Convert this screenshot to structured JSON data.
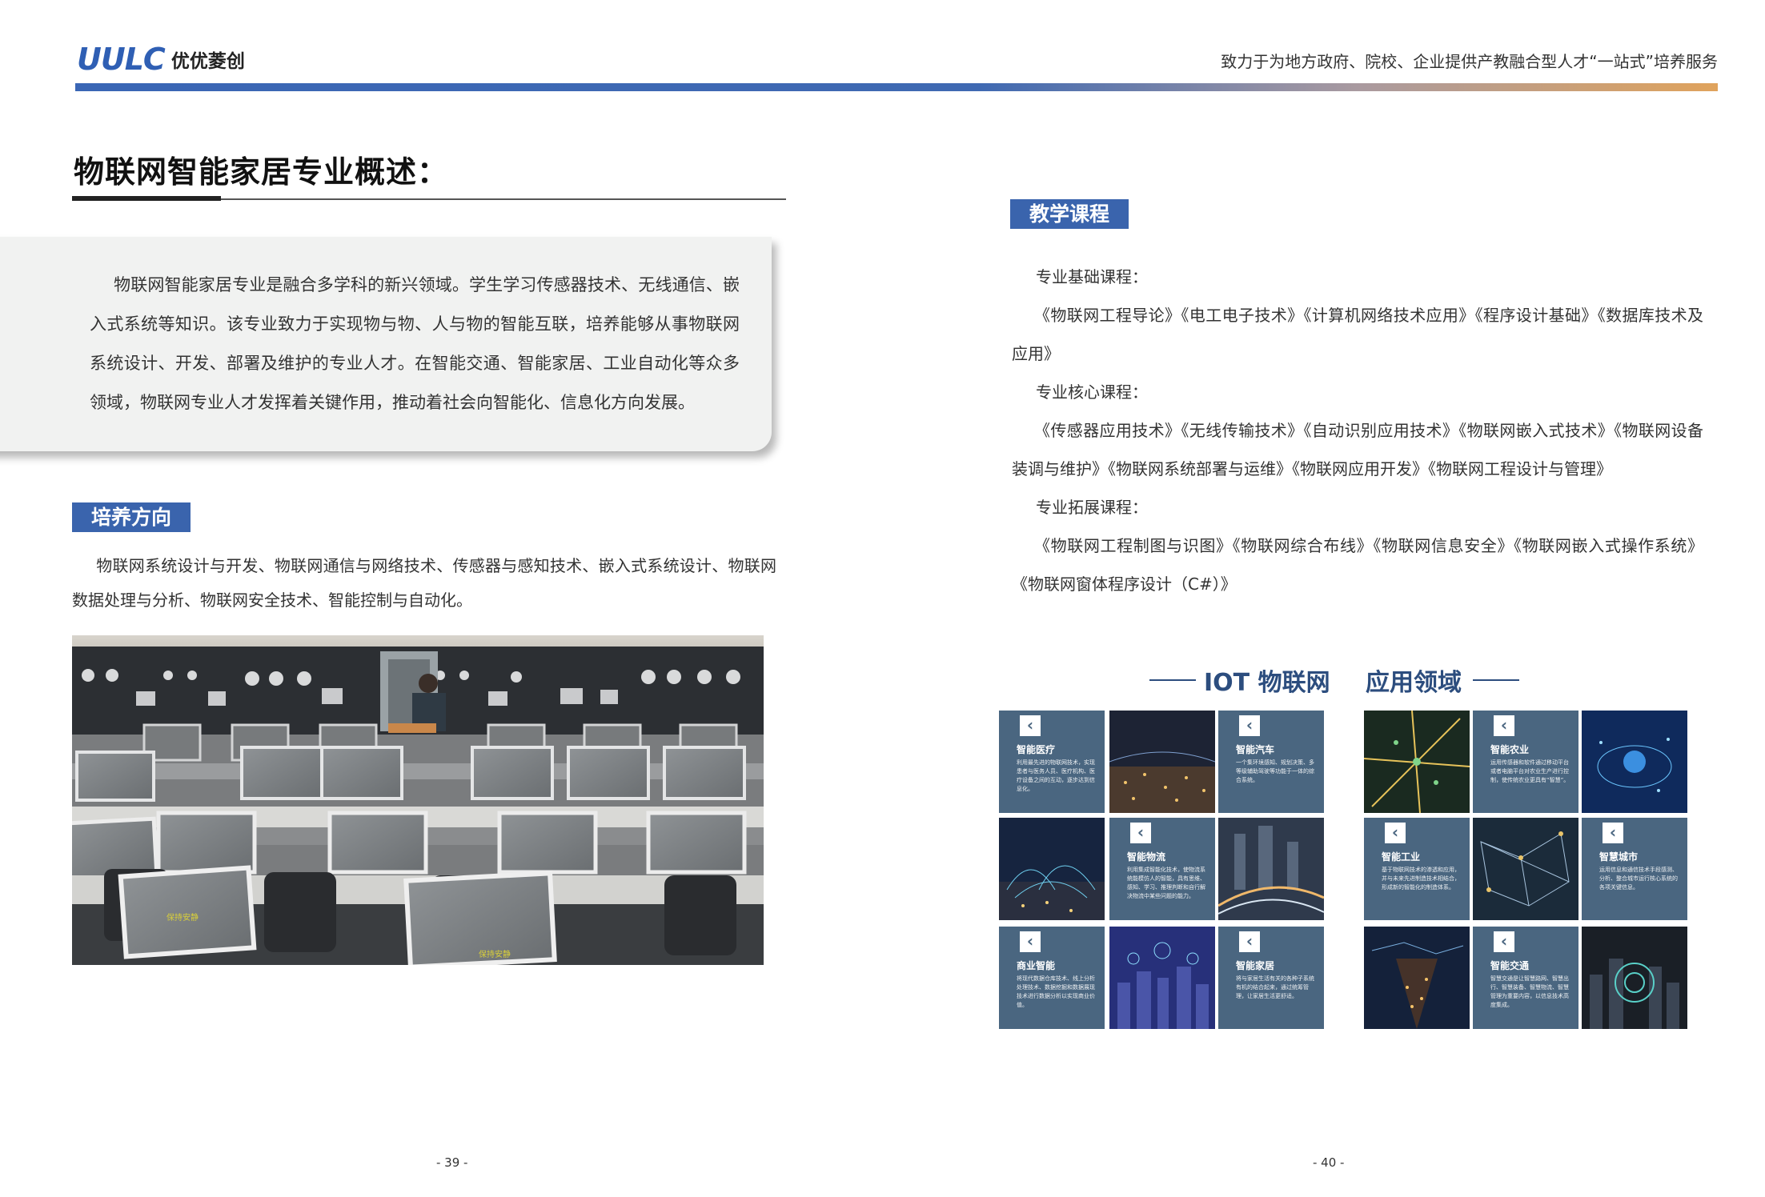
{
  "header": {
    "logo_mark": "UULC",
    "logo_cn": "优优菱创",
    "tagline": "致力于为地方政府、院校、企业提供产教融合型人才“一站式”培养服务"
  },
  "left_page": {
    "title": "物联网智能家居专业概述：",
    "intro": "物联网智能家居专业是融合多学科的新兴领域。学生学习传感器技术、无线通信、嵌入式系统等知识。该专业致力于实现物与物、人与物的智能互联，培养能够从事物联网系统设计、开发、部署及维护的专业人才。在智能交通、智能家居、工业自动化等众多领域，物联网专业人才发挥着关键作用，推动着社会向智能化、信息化方向发展。",
    "direction_tag": "培养方向",
    "direction_text": "物联网系统设计与开发、物联网通信与网络技术、传感器与感知技术、嵌入式系统设计、物联网数据处理与分析、物联网安全技术、智能控制与自动化。",
    "photo": {
      "monitor_label": "保持安静"
    },
    "page_number": "- 39 -"
  },
  "right_page": {
    "courses_tag": "教学课程",
    "courses": [
      {
        "head": "专业基础课程：",
        "body": "《物联网工程导论》《电工电子技术》《计算机网络技术应用》《程序设计基础》《数据库技术及应用》"
      },
      {
        "head": "专业核心课程：",
        "body": "《传感器应用技术》《无线传输技术》《自动识别应用技术》《物联网嵌入式技术》《物联网设备装调与维护》《物联网系统部署与运维》《物联网应用开发》《物联网工程设计与管理》"
      },
      {
        "head": "专业拓展课程：",
        "body": "《物联网工程制图与识图》《物联网综合布线》《物联网信息安全》《物联网嵌入式操作系统》《物联网窗体程序设计（C#）》"
      }
    ],
    "iot_title": "IOT 物联网",
    "app_title": "应用领域",
    "tiles": [
      {
        "title": "智能医疗",
        "desc": "利用最先进的物联网技术，实现患者与医务人员、医疗机构、医疗设备之间的互动，逐步达到信息化。"
      },
      {
        "title": "智能汽车",
        "desc": "一个集环境感知、规划决策、多等级辅助驾驶等功能于一体的综合系统。"
      },
      {
        "title": "智能物流",
        "desc": "利用集成智能化技术，使物流系统能模仿人的智能，具有思维、感知、学习、推理判断和自行解决物流中某些问题的能力。"
      },
      {
        "title": "商业智能",
        "desc": "将现代数据仓库技术、线上分析处理技术、数据挖掘和数据展现技术进行数据分析以实现商业价值。"
      },
      {
        "title": "智能家居",
        "desc": "将与家居生活有关的各种子系统有机的结合起来，通过统筹管理，让家居生活更舒适。"
      },
      {
        "title": "智能农业",
        "desc": "运用传感器和软件通过移动平台或者电脑平台对农业生产进行控制，使传统农业更具有“智慧”。"
      },
      {
        "title": "智能工业",
        "desc": "基于物联网技术的渗透和应用，并与未来先进制造技术相结合，形成新的智能化的制造体系。"
      },
      {
        "title": "智慧城市",
        "desc": "运用信息和通信技术手段感测、分析、整合城市运行核心系统的各项关键信息。"
      },
      {
        "title": "智能交通",
        "desc": "智慧交通是让智慧路网、智慧出行、智慧装备、智慧物流、智慧管理为重要内容，以信息技术高度集成。"
      }
    ],
    "page_number": "- 40 -"
  }
}
